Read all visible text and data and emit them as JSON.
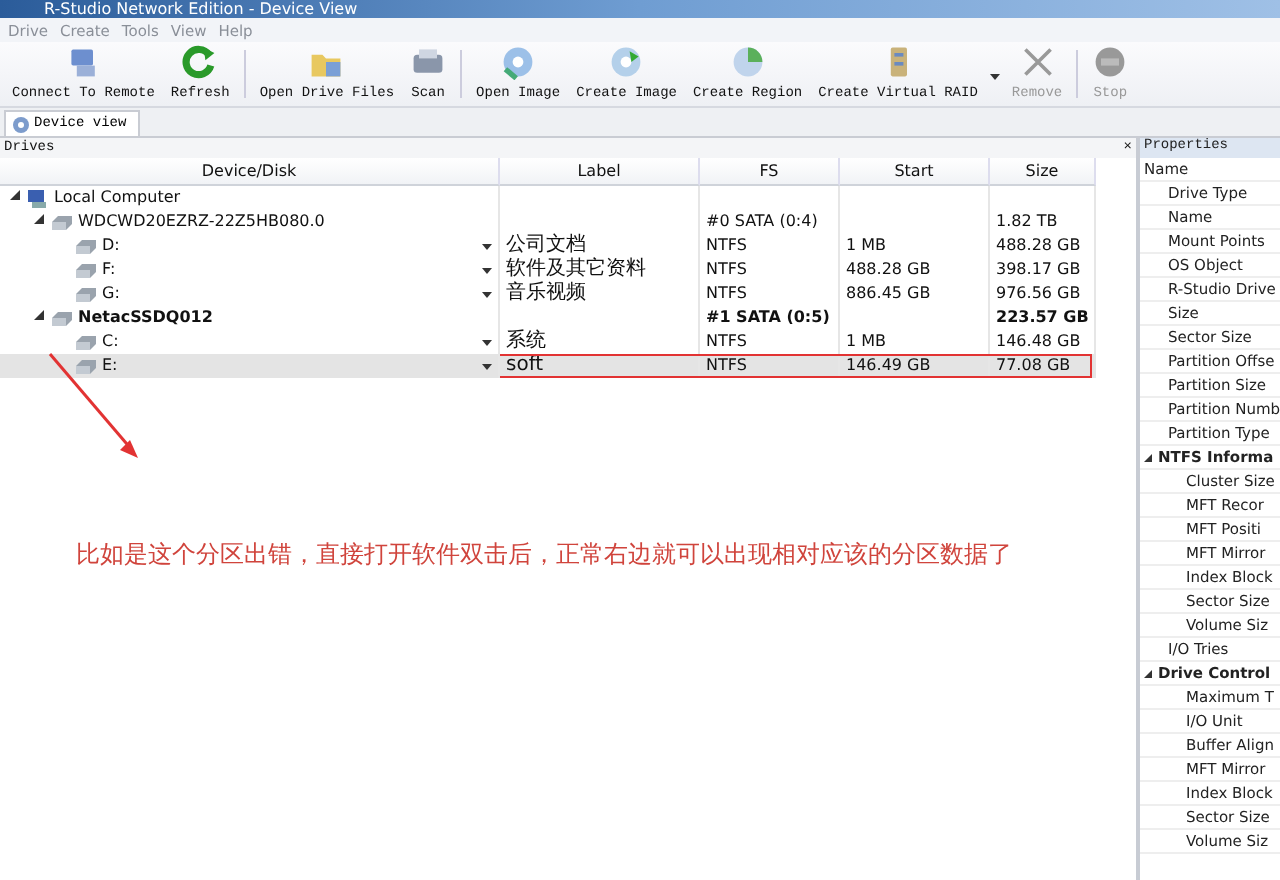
{
  "window": {
    "title": "R-Studio Network Edition - Device View"
  },
  "menu": [
    "Drive",
    "Create",
    "Tools",
    "View",
    "Help"
  ],
  "toolbar": [
    [
      {
        "label": "Connect To Remote",
        "disabled": false,
        "dropdown": false
      },
      {
        "label": "Refresh",
        "disabled": false,
        "dropdown": false
      }
    ],
    [
      {
        "label": "Open Drive Files",
        "disabled": false,
        "dropdown": false
      },
      {
        "label": "Scan",
        "disabled": false,
        "dropdown": false
      }
    ],
    [
      {
        "label": "Open Image",
        "disabled": false,
        "dropdown": false
      },
      {
        "label": "Create Image",
        "disabled": false,
        "dropdown": false
      },
      {
        "label": "Create Region",
        "disabled": false,
        "dropdown": false
      },
      {
        "label": "Create Virtual RAID",
        "disabled": false,
        "dropdown": true
      },
      {
        "label": "Remove",
        "disabled": true,
        "dropdown": false
      }
    ],
    [
      {
        "label": "Stop",
        "disabled": true,
        "dropdown": false
      }
    ]
  ],
  "tabs": [
    {
      "label": "Device view",
      "selected": true
    }
  ],
  "drives": {
    "title": "Drives",
    "close": "×",
    "columns": [
      "Device/Disk",
      "Label",
      "FS",
      "Start",
      "Size"
    ],
    "rows": [
      {
        "kind": "computer",
        "device": "Local Computer",
        "expanded": true,
        "bold": false,
        "selected": false,
        "annotated": false,
        "children": [
          {
            "kind": "disk",
            "device": "WDCWD20EZRZ-22Z5HB080.0",
            "fs": "#0 SATA (0:4)",
            "size": "1.82 TB",
            "expanded": true,
            "bold": false,
            "selected": false,
            "annotated": false,
            "children": [
              {
                "kind": "partition",
                "device": "D:",
                "label": "公司文档",
                "fs": "NTFS",
                "start": "1 MB",
                "size": "488.28 GB",
                "bold": false,
                "selected": false,
                "annotated": false
              },
              {
                "kind": "partition",
                "device": "F:",
                "label": "软件及其它资料",
                "fs": "NTFS",
                "start": "488.28 GB",
                "size": "398.17 GB",
                "bold": false,
                "selected": false,
                "annotated": false
              },
              {
                "kind": "partition",
                "device": "G:",
                "label": "音乐视频",
                "fs": "NTFS",
                "start": "886.45 GB",
                "size": "976.56 GB",
                "bold": false,
                "selected": false,
                "annotated": false
              }
            ]
          },
          {
            "kind": "disk",
            "device": "NetacSSDQ012",
            "fs": "#1 SATA (0:5)",
            "size": "223.57 GB",
            "expanded": true,
            "bold": true,
            "selected": false,
            "annotated": false,
            "children": [
              {
                "kind": "partition",
                "device": "C:",
                "label": "系统",
                "fs": "NTFS",
                "start": "1 MB",
                "size": "146.48 GB",
                "bold": false,
                "selected": false,
                "annotated": false
              },
              {
                "kind": "partition",
                "device": "E:",
                "label": "soft",
                "fs": "NTFS",
                "start": "146.49 GB",
                "size": "77.08 GB",
                "bold": false,
                "selected": true,
                "annotated": true
              }
            ]
          }
        ]
      }
    ]
  },
  "annotation": {
    "text": "比如是这个分区出错，直接打开软件双击后，正常右边就可以出现相对应该的分区数据了"
  },
  "properties": {
    "title": "Properties",
    "header": "Name",
    "items": [
      {
        "label": "Drive Type"
      },
      {
        "label": "Name"
      },
      {
        "label": "Mount Points"
      },
      {
        "label": "OS Object"
      },
      {
        "label": "R-Studio Drive"
      },
      {
        "label": "Size"
      },
      {
        "label": "Sector Size"
      },
      {
        "label": "Partition Offse"
      },
      {
        "label": "Partition Size"
      },
      {
        "label": "Partition Numb"
      },
      {
        "label": "Partition Type"
      },
      {
        "label": "NTFS Informa",
        "expanded": true,
        "children": [
          {
            "label": "Cluster Size"
          },
          {
            "label": "MFT Recor"
          },
          {
            "label": "MFT Positi"
          },
          {
            "label": "MFT Mirror"
          },
          {
            "label": "Index Block"
          },
          {
            "label": "Sector Size"
          },
          {
            "label": "Volume Siz"
          }
        ]
      },
      {
        "label": "I/O Tries"
      },
      {
        "label": "Drive Control",
        "expanded": true,
        "children": [
          {
            "label": "Maximum T"
          },
          {
            "label": "I/O Unit"
          },
          {
            "label": "Buffer Align"
          },
          {
            "label": "MFT Mirror"
          },
          {
            "label": "Index Block"
          },
          {
            "label": "Sector Size"
          },
          {
            "label": "Volume Siz"
          }
        ]
      }
    ]
  }
}
